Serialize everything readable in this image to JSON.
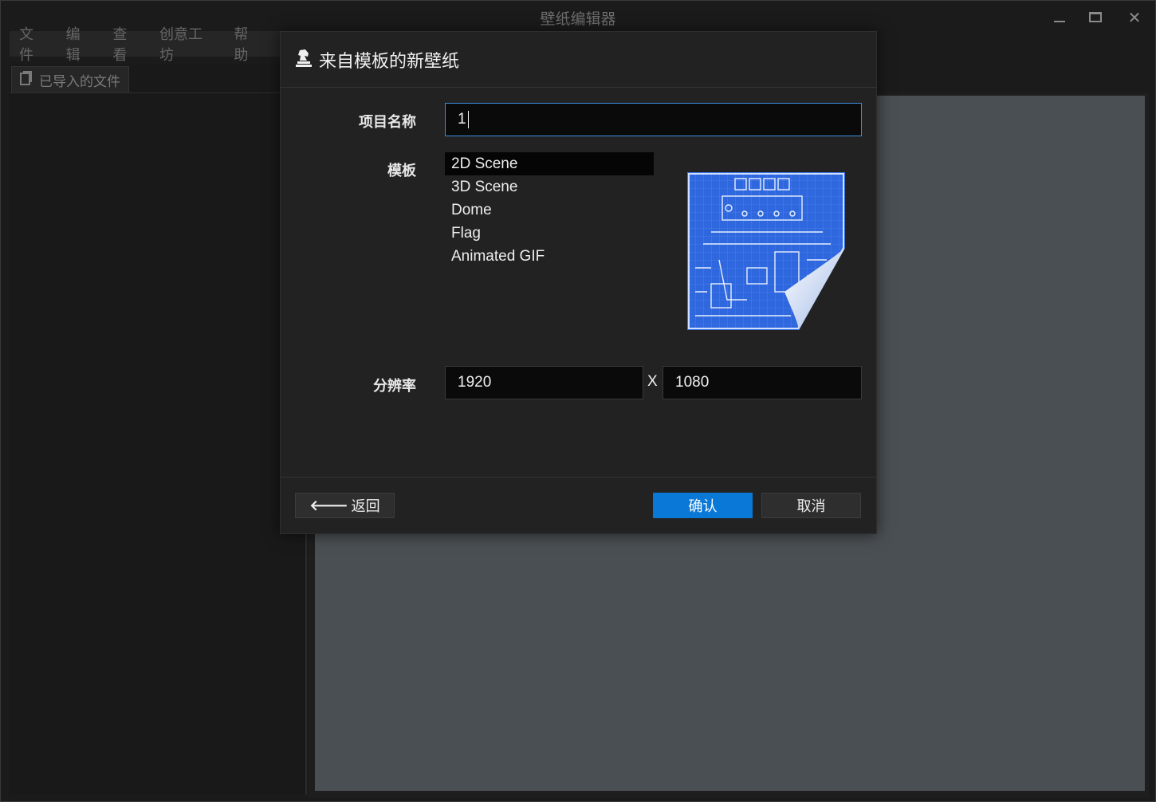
{
  "app": {
    "title": "壁纸编辑器",
    "window_controls": [
      "minimize-icon",
      "maximize-icon",
      "close-icon"
    ]
  },
  "menu": [
    "文件",
    "编辑",
    "查看",
    "创意工坊",
    "帮助"
  ],
  "left_panel": {
    "tab_label": "已导入的文件",
    "tab_icon": "files-icon"
  },
  "dialog": {
    "title": "来自模板的新壁纸",
    "title_icon": "chess-knight-icon",
    "project_name_label": "项目名称",
    "project_name_value": "1",
    "template_label": "模板",
    "templates": [
      "2D Scene",
      "3D Scene",
      "Dome",
      "Flag",
      "Animated GIF"
    ],
    "selected_template": "2D Scene",
    "resolution_label": "分辨率",
    "width": "1920",
    "separator": "X",
    "height": "1080",
    "back_label": "返回",
    "confirm_label": "确认",
    "cancel_label": "取消"
  },
  "colors": {
    "accent": "#0a78d7",
    "canvas": "#4a4f53",
    "dialog_bg": "#222222"
  }
}
